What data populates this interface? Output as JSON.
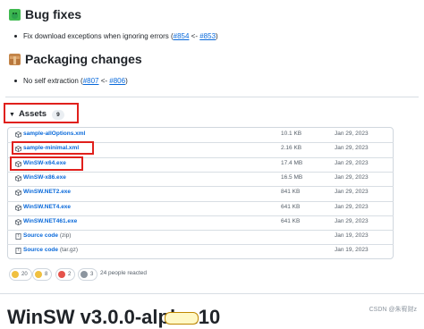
{
  "sections": {
    "bug_fixes": {
      "title": "Bug fixes",
      "item": {
        "text_before": "Fix download exceptions when ignoring errors (",
        "link1": "#854",
        "between": " <- ",
        "link2": "#853",
        "text_after": ")"
      }
    },
    "packaging": {
      "title": "Packaging changes",
      "item": {
        "text_before": "No self extraction (",
        "link1": "#807",
        "between": " <- ",
        "link2": "#806",
        "text_after": ")"
      }
    }
  },
  "assets": {
    "label": "Assets",
    "count": "9",
    "rows": [
      {
        "name": "sample-allOptions.xml",
        "size": "10.1 KB",
        "date": "Jan 29, 2023",
        "icon": "package-icon"
      },
      {
        "name": "sample-minimal.xml",
        "size": "2.16 KB",
        "date": "Jan 29, 2023",
        "icon": "package-icon"
      },
      {
        "name": "WinSW-x64.exe",
        "size": "17.4 MB",
        "date": "Jan 29, 2023",
        "icon": "package-icon"
      },
      {
        "name": "WinSW-x86.exe",
        "size": "16.5 MB",
        "date": "Jan 29, 2023",
        "icon": "package-icon"
      },
      {
        "name": "WinSW.NET2.exe",
        "size": "841 KB",
        "date": "Jan 29, 2023",
        "icon": "package-icon"
      },
      {
        "name": "WinSW.NET4.exe",
        "size": "641 KB",
        "date": "Jan 29, 2023",
        "icon": "package-icon"
      },
      {
        "name": "WinSW.NET461.exe",
        "size": "641 KB",
        "date": "Jan 29, 2023",
        "icon": "package-icon"
      },
      {
        "name": "Source code",
        "suffix": "(zip)",
        "size": "",
        "date": "Jan 19, 2023",
        "icon": "file-zip-icon"
      },
      {
        "name": "Source code",
        "suffix": "(tar.gz)",
        "size": "",
        "date": "Jan 19, 2023",
        "icon": "file-zip-icon"
      }
    ]
  },
  "reactions": {
    "items": [
      {
        "icon": "thumbs-up-icon",
        "count": "20"
      },
      {
        "icon": "laugh-icon",
        "count": "8"
      },
      {
        "icon": "heart-icon",
        "count": "2"
      },
      {
        "icon": "rocket-icon",
        "count": "3"
      }
    ],
    "summary": "24 people reacted"
  },
  "next_release": {
    "title": "WinSW v3.0.0-alpha.10"
  },
  "watermark": "CSDN @朱宥财z",
  "colors": {
    "link": "#0969da",
    "highlight": "#e0201c",
    "border": "#d0d7de",
    "muted": "#57606a"
  }
}
